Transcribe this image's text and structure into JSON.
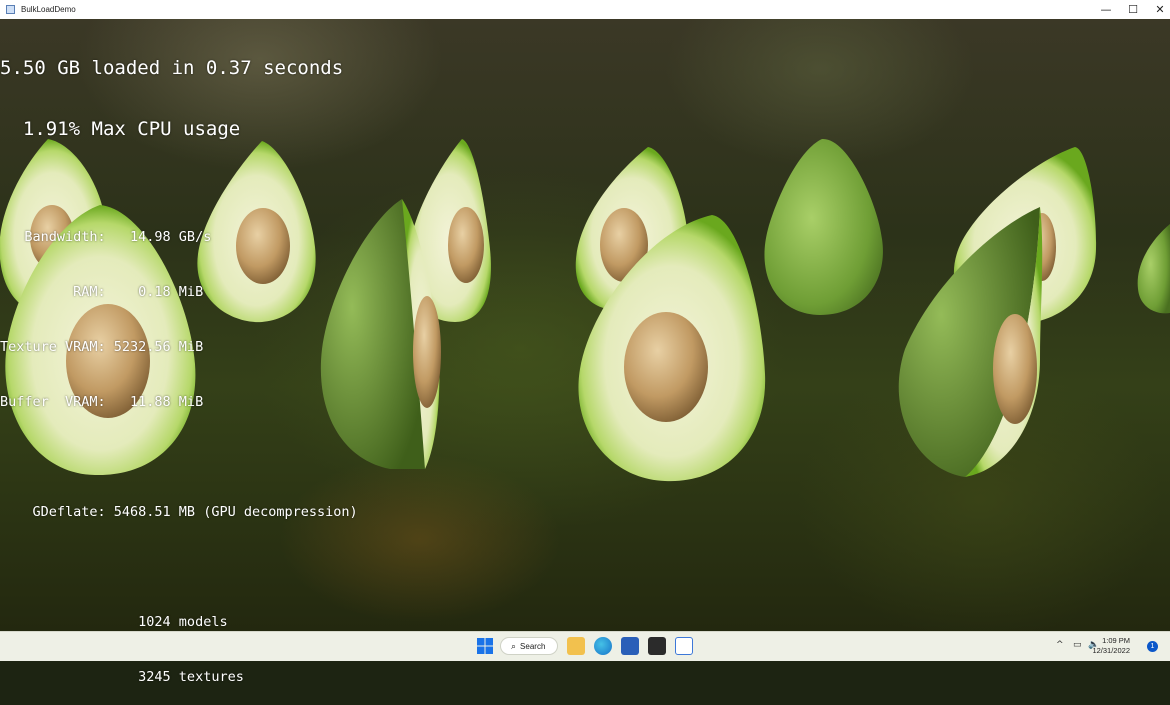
{
  "window": {
    "title": "BulkLoadDemo",
    "controls": {
      "minimize": "—",
      "maximize": "☐",
      "close": "✕"
    }
  },
  "overlay": {
    "line1": "5.50 GB loaded in 0.37 seconds",
    "line2": "  1.91% Max CPU usage",
    "stats": [
      "   Bandwidth:   14.98 GB/s",
      "         RAM:    0.18 MiB",
      "Texture VRAM: 5232.56 MiB",
      "Buffer  VRAM:   11.88 MiB"
    ],
    "gdeflate": "    GDeflate: 5468.51 MB (GPU decompression)",
    "models": "                 1024 models",
    "textures": "                 3245 textures"
  },
  "taskbar": {
    "search_label": "Search",
    "icons": [
      "windows-start-icon",
      "search-icon",
      "file-explorer-icon",
      "edge-browser-icon",
      "store-icon",
      "terminal-icon",
      "bulkloaddemo-app-icon"
    ],
    "tray_chevron": "^",
    "time": "1:09 PM",
    "date": "12/31/2022",
    "notification_count": "1"
  }
}
